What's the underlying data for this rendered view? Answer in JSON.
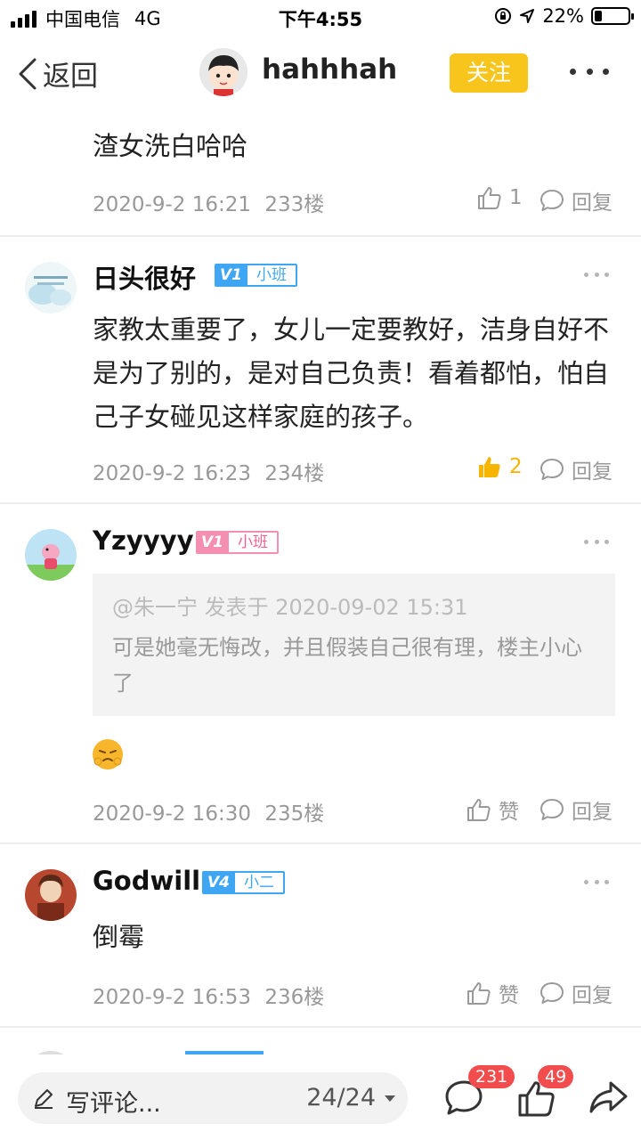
{
  "status_bar": {
    "carrier": "中国电信",
    "network": "4G",
    "time": "下午4:55",
    "battery_text": "22%",
    "battery_level": 0.22
  },
  "nav": {
    "back_label": "返回",
    "title": "hahhhah",
    "follow_label": "关注"
  },
  "posts": [
    {
      "text": "渣女洗白哈哈",
      "date": "2020-9-2 16:21",
      "floor": "233楼",
      "like_label": "1",
      "reply_label": "回复"
    },
    {
      "username": "日头很好",
      "level": "V1",
      "rank": "小班",
      "text": "家教太重要了，女儿一定要教好，洁身自好不是为了别的，是对自己负责！看着都怕，怕自己子女碰见这样家庭的孩子。",
      "date": "2020-9-2 16:23",
      "floor": "234楼",
      "like_label": "2",
      "reply_label": "回复"
    },
    {
      "username": "Yzyyyy",
      "level": "V1",
      "rank": "小班",
      "quote_head": "@朱一宁 发表于 2020-09-02 15:31",
      "quote_body": "可是她毫无悔改，并且假装自己很有理，楼主小心了",
      "date": "2020-9-2 16:30",
      "floor": "235楼",
      "like_label": "赞",
      "reply_label": "回复"
    },
    {
      "username": "Godwill",
      "level": "V4",
      "rank": "小二",
      "text": "倒霉",
      "date": "2020-9-2 16:53",
      "floor": "236楼",
      "like_label": "赞",
      "reply_label": "回复"
    }
  ],
  "bottom_bar": {
    "comment_placeholder": "写评论...",
    "pager": "24/24",
    "comment_count": "231",
    "like_count": "49"
  },
  "colors": {
    "accent": "#f8c51c",
    "liked": "#f7b500",
    "level_blue": "#3ea6f2",
    "level_pink": "#f48fb1",
    "badge_red": "#f24c4c"
  }
}
